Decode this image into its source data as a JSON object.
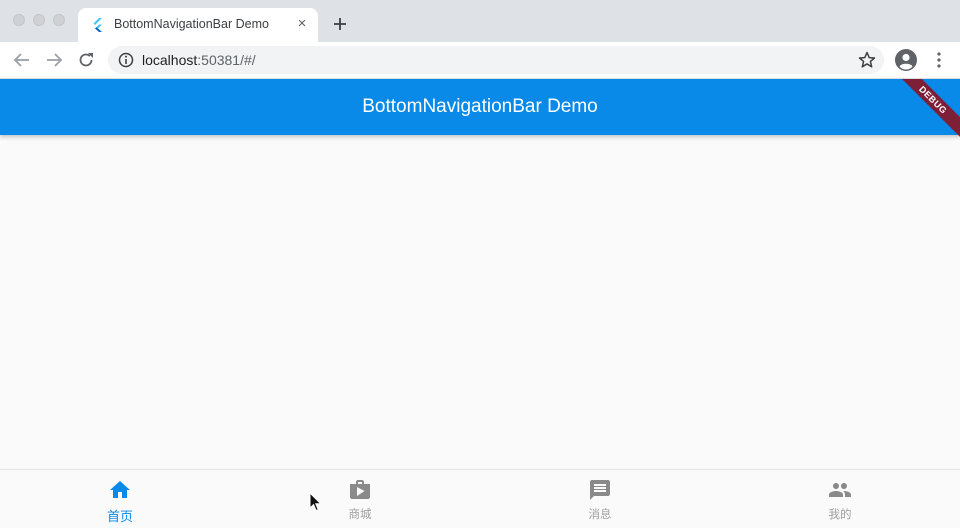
{
  "browser": {
    "tab_title": "BottomNavigationBar Demo",
    "tab_close": "×",
    "url_host": "localhost",
    "url_rest": ":50381/#/"
  },
  "app": {
    "title": "BottomNavigationBar Demo",
    "debug_banner": "DEBUG",
    "accent_color": "#0a8ae8",
    "inactive_color": "#9e9e9e",
    "bottom_nav": {
      "selected_index": 0,
      "items": [
        {
          "label": "首页",
          "icon": "home-icon"
        },
        {
          "label": "商城",
          "icon": "shop-icon"
        },
        {
          "label": "消息",
          "icon": "message-icon"
        },
        {
          "label": "我的",
          "icon": "people-icon"
        }
      ]
    }
  }
}
